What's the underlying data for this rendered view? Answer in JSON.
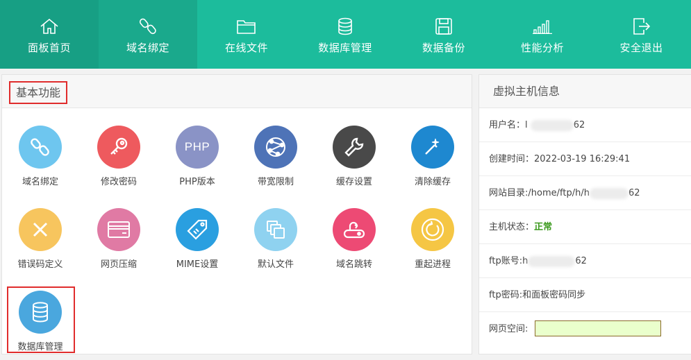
{
  "nav": {
    "items": [
      {
        "label": "面板首页",
        "icon": "home-icon"
      },
      {
        "label": "域名绑定",
        "icon": "link-icon"
      },
      {
        "label": "在线文件",
        "icon": "folder-icon"
      },
      {
        "label": "数据库管理",
        "icon": "database-icon"
      },
      {
        "label": "数据备份",
        "icon": "save-icon"
      },
      {
        "label": "性能分析",
        "icon": "signal-bars-icon"
      },
      {
        "label": "安全退出",
        "icon": "logout-icon"
      }
    ]
  },
  "basic": {
    "title": "基本功能",
    "tiles": [
      {
        "label": "域名绑定",
        "icon": "link-icon",
        "color": "#6ec6ef"
      },
      {
        "label": "修改密码",
        "icon": "key-icon",
        "color": "#ee5a5e"
      },
      {
        "label": "PHP版本",
        "icon": "php-icon",
        "color": "#8a93c6",
        "icon_text": "PHP"
      },
      {
        "label": "带宽限制",
        "icon": "network-icon",
        "color": "#4e73b7"
      },
      {
        "label": "缓存设置",
        "icon": "wrench-icon",
        "color": "#494949"
      },
      {
        "label": "清除缓存",
        "icon": "magic-wand-icon",
        "color": "#1e88d0"
      },
      {
        "label": "错误码定义",
        "icon": "close-icon",
        "color": "#f7c55e"
      },
      {
        "label": "网页压缩",
        "icon": "card-icon",
        "color": "#e07aa4"
      },
      {
        "label": "MIME设置",
        "icon": "tag-icon",
        "color": "#2a9fe0"
      },
      {
        "label": "默认文件",
        "icon": "files-icon",
        "color": "#8fd2f0"
      },
      {
        "label": "域名跳转",
        "icon": "redirect-icon",
        "color": "#ed4a74"
      },
      {
        "label": "重起进程",
        "icon": "restart-icon",
        "color": "#f5c644"
      },
      {
        "label": "数据库管理",
        "icon": "database-icon",
        "color": "#4aa7de"
      }
    ]
  },
  "hostinfo": {
    "title": "虚拟主机信息",
    "username_label": "用户名：",
    "username_prefix": "l",
    "username_suffix": "62",
    "created_label": "创建时间：",
    "created_value": "2022-03-19 16:29:41",
    "webdir_label": "网站目录:",
    "webdir_prefix": "/home/ftp/h/h",
    "webdir_suffix": "62",
    "status_label": "主机状态：",
    "status_value": "正常",
    "ftp_account_label": "ftp账号:",
    "ftp_account_prefix": "h",
    "ftp_account_suffix": "62",
    "ftp_password_label": "ftp密码:",
    "ftp_password_value": "和面板密码同步",
    "space_label": "网页空间:",
    "status_color": "#3c9a1e"
  }
}
